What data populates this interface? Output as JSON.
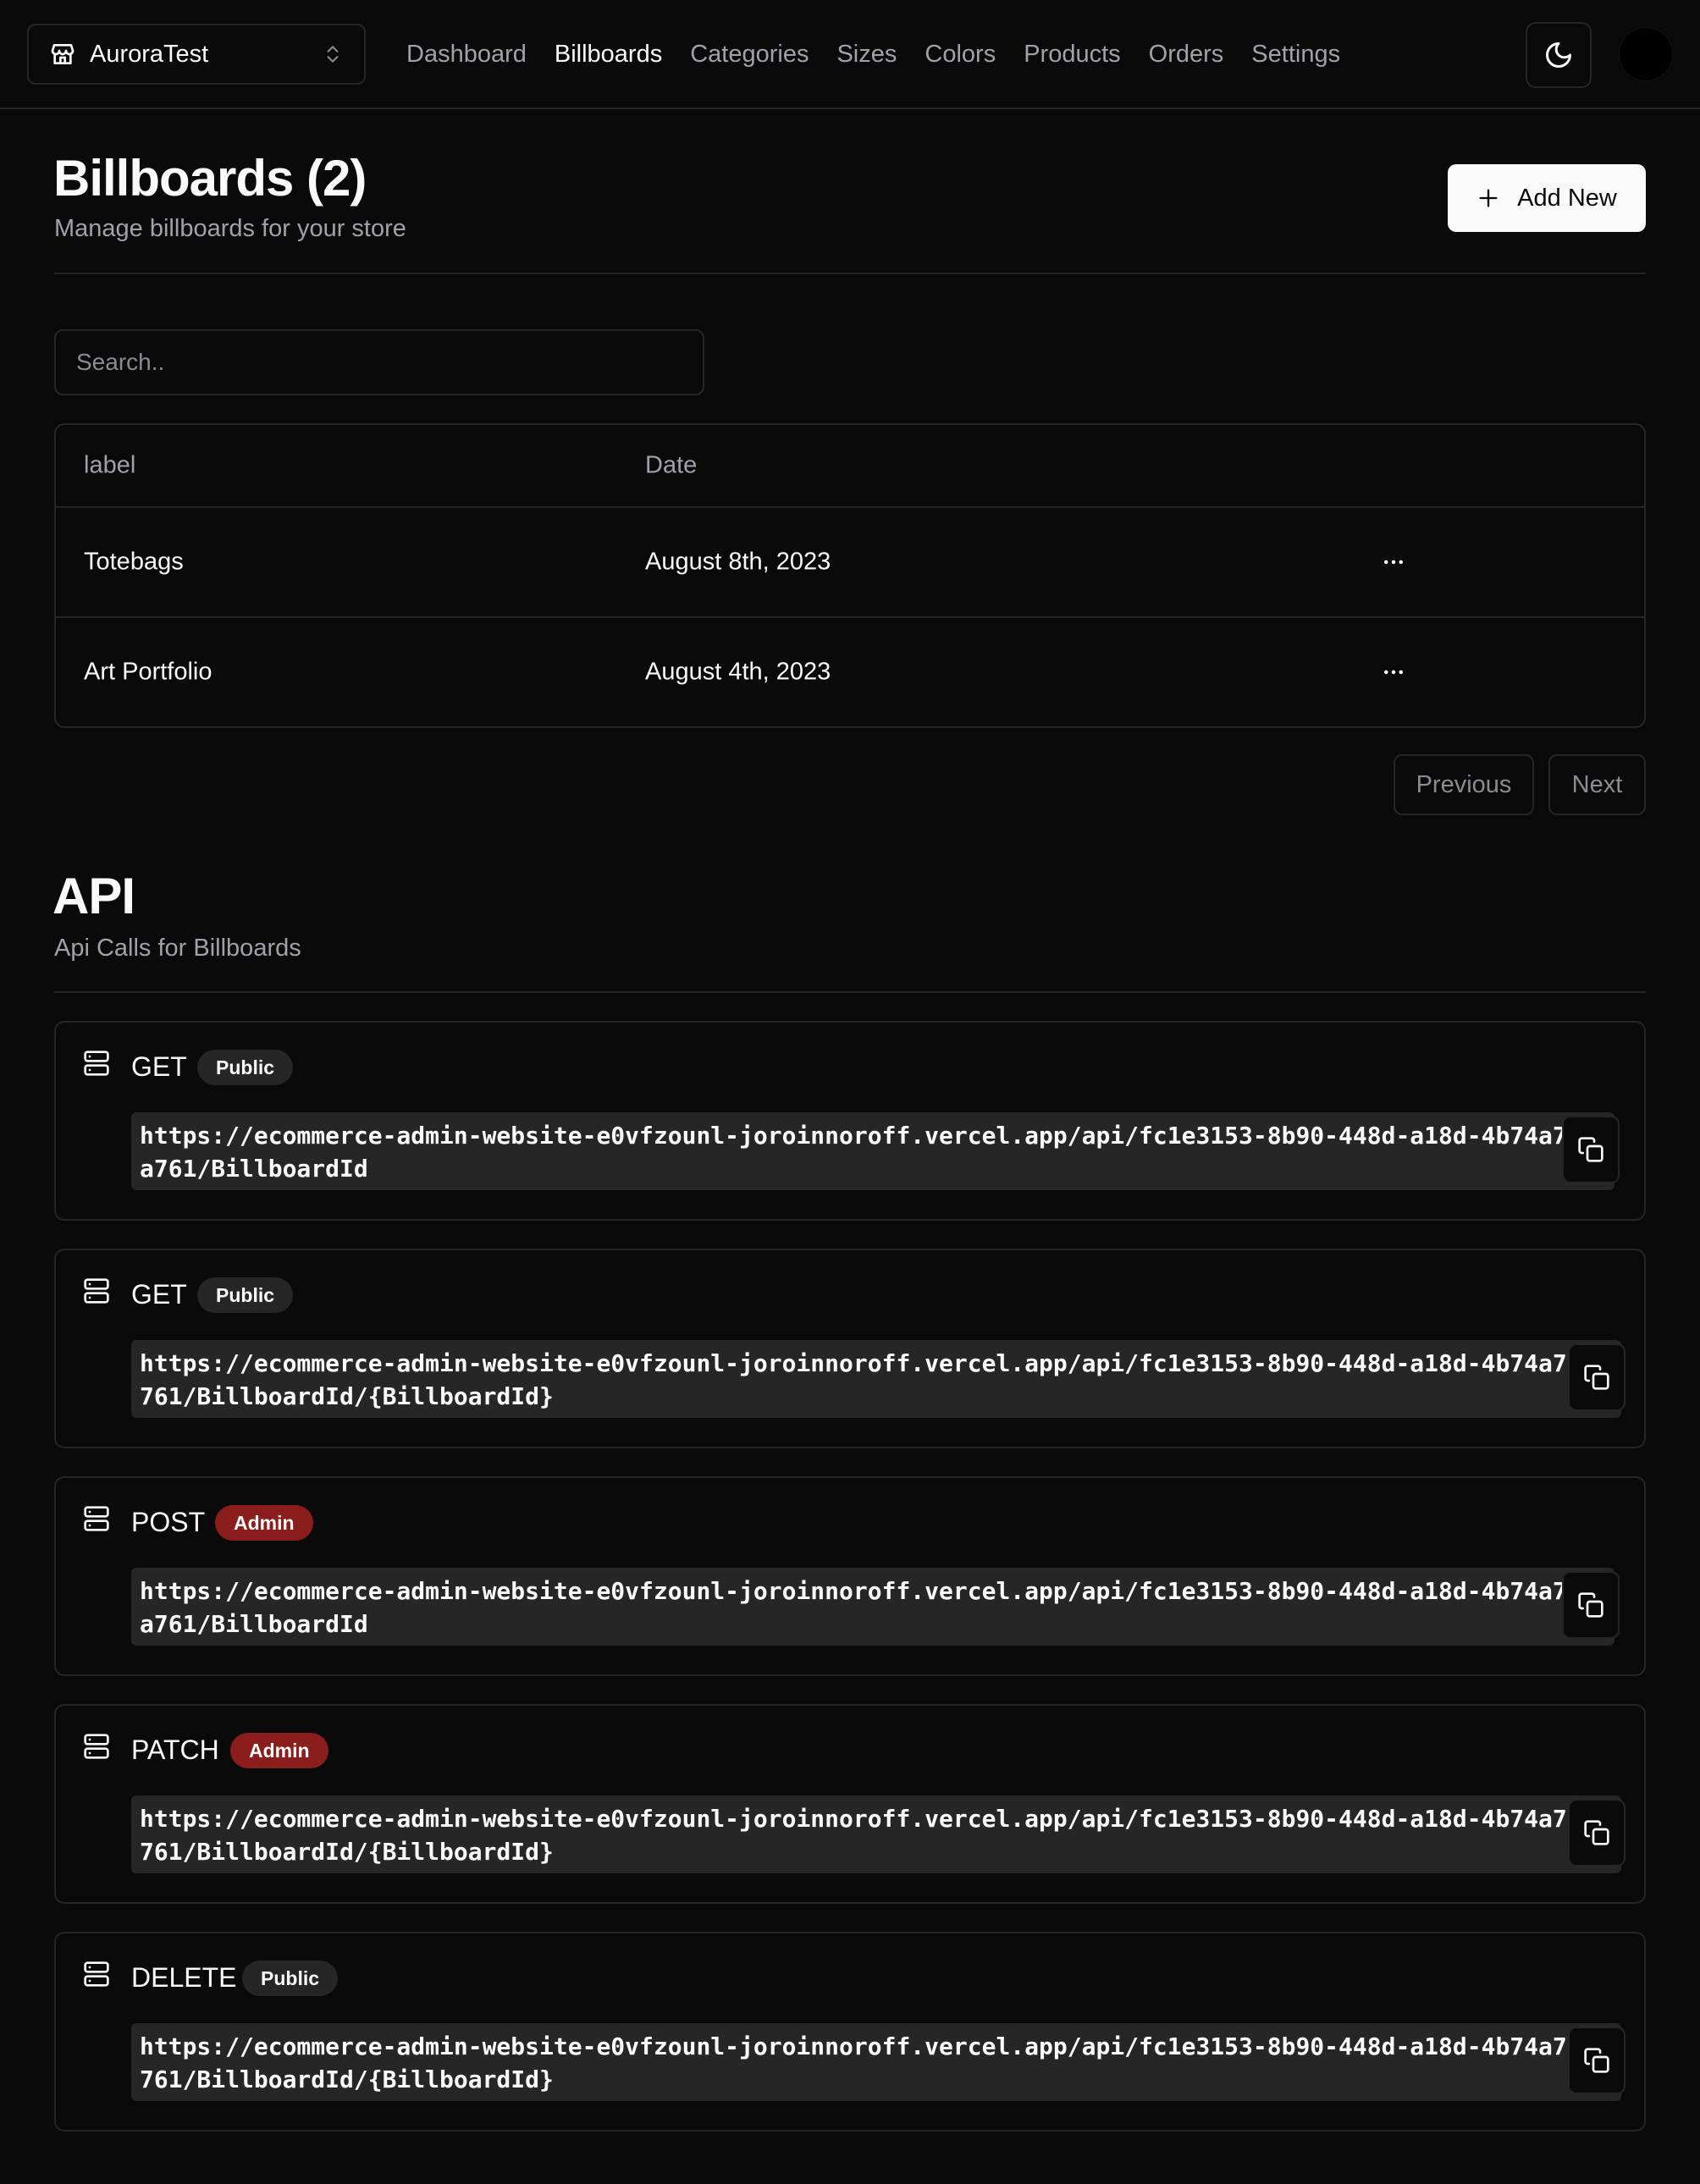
{
  "nav": {
    "store_name": "AuroraTest",
    "links": [
      "Dashboard",
      "Billboards",
      "Categories",
      "Sizes",
      "Colors",
      "Products",
      "Orders",
      "Settings"
    ],
    "active_link": "Billboards"
  },
  "header": {
    "title": "Billboards (2)",
    "subtitle": "Manage billboards for your store",
    "add_new_label": "Add New"
  },
  "search": {
    "placeholder": "Search.."
  },
  "table": {
    "columns": [
      "label",
      "Date"
    ],
    "rows": [
      {
        "label": "Totebags",
        "date": "August 8th, 2023"
      },
      {
        "label": "Art Portfolio",
        "date": "August 4th, 2023"
      }
    ]
  },
  "pagination": {
    "previous": "Previous",
    "next": "Next"
  },
  "api": {
    "title": "API",
    "subtitle": "Api Calls for Billboards",
    "routes": [
      {
        "method": "GET",
        "access": "Public",
        "url": "https://ecommerce-admin-website-e0vfzounl-joroinnoroff.vercel.app/api/fc1e3153-8b90-448d-a18d-4b74a7a2a761/BillboardId"
      },
      {
        "method": "GET",
        "access": "Public",
        "url": "https://ecommerce-admin-website-e0vfzounl-joroinnoroff.vercel.app/api/fc1e3153-8b90-448d-a18d-4b74a7a2a761/BillboardId/{BillboardId}"
      },
      {
        "method": "POST",
        "access": "Admin",
        "url": "https://ecommerce-admin-website-e0vfzounl-joroinnoroff.vercel.app/api/fc1e3153-8b90-448d-a18d-4b74a7a2a761/BillboardId"
      },
      {
        "method": "PATCH",
        "access": "Admin",
        "url": "https://ecommerce-admin-website-e0vfzounl-joroinnoroff.vercel.app/api/fc1e3153-8b90-448d-a18d-4b74a7a2a761/BillboardId/{BillboardId}"
      },
      {
        "method": "DELETE",
        "access": "Public",
        "url": "https://ecommerce-admin-website-e0vfzounl-joroinnoroff.vercel.app/api/fc1e3153-8b90-448d-a18d-4b74a7a2a761/BillboardId/{BillboardId}"
      }
    ]
  },
  "colors": {
    "background": "#0a0a0a",
    "border": "#262626",
    "admin_badge": "#8b1d1d",
    "muted_text": "#a1a1aa"
  }
}
